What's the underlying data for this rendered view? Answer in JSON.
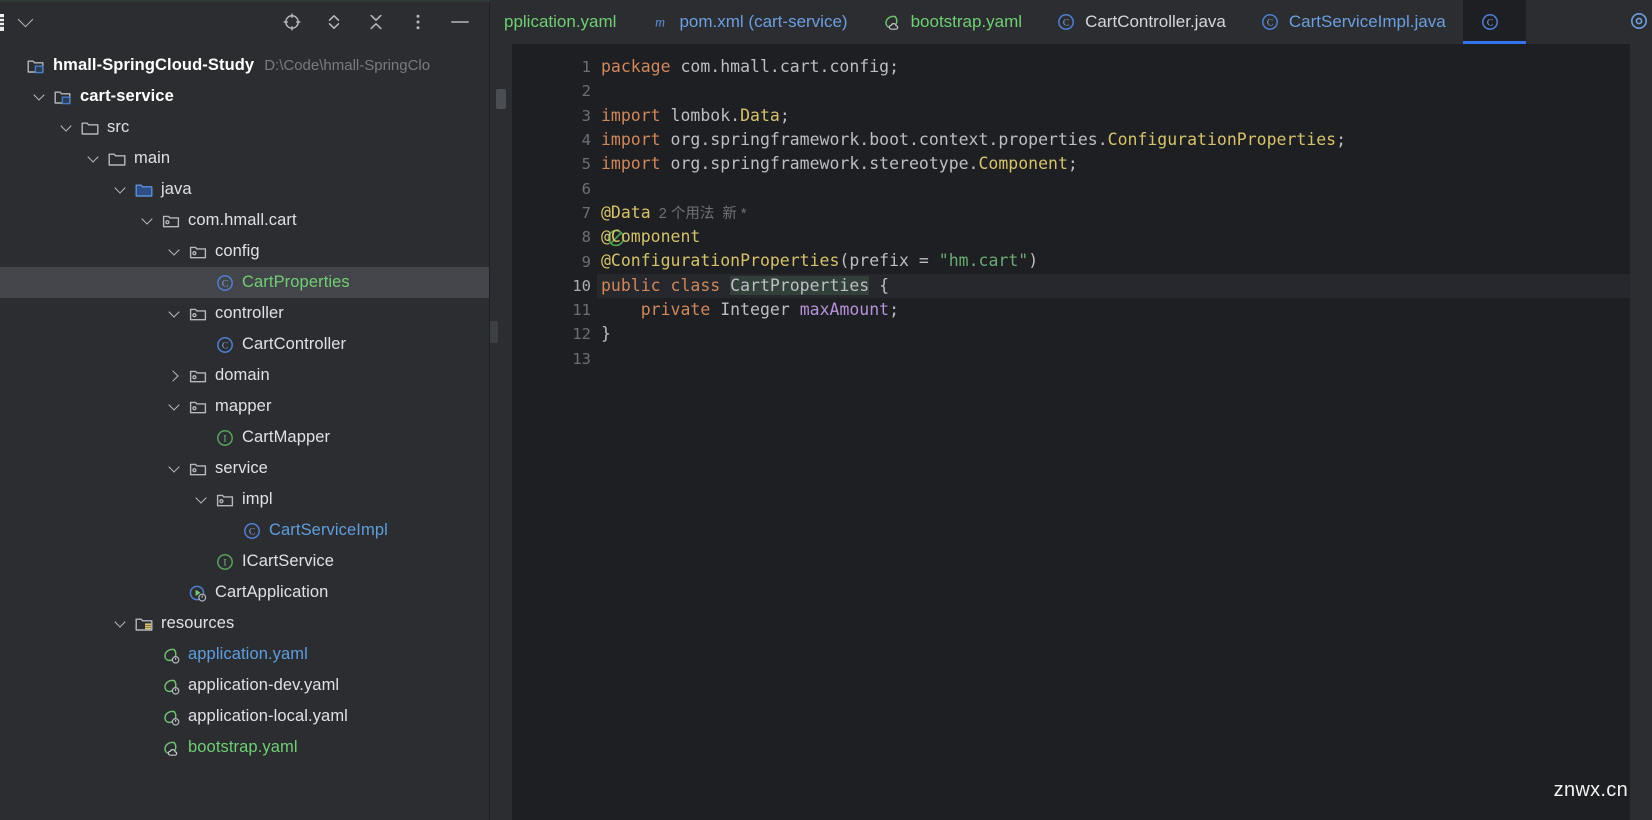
{
  "window": {
    "watermark": "znwx.cn"
  },
  "project_panel": {
    "toolbar": {
      "project_selector_label": "",
      "icons": [
        {
          "name": "locate-icon",
          "title": "Select Opened File"
        },
        {
          "name": "expand-all-icon",
          "title": "Expand All"
        },
        {
          "name": "collapse-all-icon",
          "title": "Collapse All"
        },
        {
          "name": "more-options-icon",
          "title": "Options"
        },
        {
          "name": "minimize-icon",
          "title": "Hide"
        }
      ]
    },
    "tree": [
      {
        "label": "hmall-SpringCloud-Study",
        "path": "D:\\Code\\hmall-SpringClo",
        "icon": "module-folder-icon",
        "indent": 0,
        "arrow": "none",
        "style": "bold",
        "selected": false
      },
      {
        "label": "cart-service",
        "path": "",
        "icon": "module-folder-icon",
        "indent": 1,
        "arrow": "down",
        "style": "bold",
        "selected": false
      },
      {
        "label": "src",
        "path": "",
        "icon": "folder-icon",
        "indent": 2,
        "arrow": "down",
        "style": "plain",
        "selected": false
      },
      {
        "label": "main",
        "path": "",
        "icon": "folder-icon",
        "indent": 3,
        "arrow": "down",
        "style": "plain",
        "selected": false
      },
      {
        "label": "java",
        "path": "",
        "icon": "source-folder-icon",
        "indent": 4,
        "arrow": "down",
        "style": "plain",
        "selected": false
      },
      {
        "label": "com.hmall.cart",
        "path": "",
        "icon": "package-icon",
        "indent": 5,
        "arrow": "down",
        "style": "plain",
        "selected": false
      },
      {
        "label": "config",
        "path": "",
        "icon": "package-icon",
        "indent": 6,
        "arrow": "down",
        "style": "plain",
        "selected": false
      },
      {
        "label": "CartProperties",
        "path": "",
        "icon": "java-class-icon",
        "indent": 7,
        "arrow": "none",
        "style": "green",
        "selected": true
      },
      {
        "label": "controller",
        "path": "",
        "icon": "package-icon",
        "indent": 6,
        "arrow": "down",
        "style": "plain",
        "selected": false
      },
      {
        "label": "CartController",
        "path": "",
        "icon": "java-class-icon",
        "indent": 7,
        "arrow": "none",
        "style": "plain",
        "selected": false
      },
      {
        "label": "domain",
        "path": "",
        "icon": "package-icon",
        "indent": 6,
        "arrow": "right",
        "style": "plain",
        "selected": false
      },
      {
        "label": "mapper",
        "path": "",
        "icon": "package-icon",
        "indent": 6,
        "arrow": "down",
        "style": "plain",
        "selected": false
      },
      {
        "label": "CartMapper",
        "path": "",
        "icon": "java-interface-icon",
        "indent": 7,
        "arrow": "none",
        "style": "plain",
        "selected": false
      },
      {
        "label": "service",
        "path": "",
        "icon": "package-icon",
        "indent": 6,
        "arrow": "down",
        "style": "plain",
        "selected": false
      },
      {
        "label": "impl",
        "path": "",
        "icon": "package-icon",
        "indent": 7,
        "arrow": "down",
        "style": "plain",
        "selected": false
      },
      {
        "label": "CartServiceImpl",
        "path": "",
        "icon": "java-class-icon",
        "indent": 8,
        "arrow": "none",
        "style": "blue",
        "selected": false
      },
      {
        "label": "ICartService",
        "path": "",
        "icon": "java-interface-icon",
        "indent": 7,
        "arrow": "none",
        "style": "plain",
        "selected": false
      },
      {
        "label": "CartApplication",
        "path": "",
        "icon": "spring-boot-class-icon",
        "indent": 6,
        "arrow": "none",
        "style": "plain",
        "selected": false
      },
      {
        "label": "resources",
        "path": "",
        "icon": "resources-folder-icon",
        "indent": 4,
        "arrow": "down",
        "style": "plain",
        "selected": false
      },
      {
        "label": "application.yaml",
        "path": "",
        "icon": "spring-yaml-icon",
        "indent": 5,
        "arrow": "none",
        "style": "blue",
        "selected": false
      },
      {
        "label": "application-dev.yaml",
        "path": "",
        "icon": "spring-yaml-icon",
        "indent": 5,
        "arrow": "none",
        "style": "plain",
        "selected": false
      },
      {
        "label": "application-local.yaml",
        "path": "",
        "icon": "spring-yaml-icon",
        "indent": 5,
        "arrow": "none",
        "style": "plain",
        "selected": false
      },
      {
        "label": "bootstrap.yaml",
        "path": "",
        "icon": "spring-cloud-yaml-icon",
        "indent": 5,
        "arrow": "none",
        "style": "green",
        "selected": false
      }
    ]
  },
  "editor": {
    "tabs": [
      {
        "label": "pplication.yaml",
        "icon": "spring-yaml-icon",
        "color": "yaml-green",
        "active": false,
        "clipped": true
      },
      {
        "label": "pom.xml (cart-service)",
        "icon": "maven-icon",
        "color": "blue",
        "active": false,
        "clipped": false
      },
      {
        "label": "bootstrap.yaml",
        "icon": "spring-cloud-yaml-icon",
        "color": "yaml-green",
        "active": false,
        "clipped": false
      },
      {
        "label": "CartController.java",
        "icon": "java-class-icon",
        "color": "white",
        "active": false,
        "clipped": false
      },
      {
        "label": "CartServiceImpl.java",
        "icon": "java-class-icon",
        "color": "blue",
        "active": false,
        "clipped": false
      },
      {
        "label": "",
        "icon": "java-class-icon",
        "color": "white",
        "active": true,
        "clipped": true
      }
    ],
    "gutter": {
      "line_numbers": [
        "1",
        "2",
        "3",
        "4",
        "5",
        "6",
        "7",
        "8",
        "9",
        "10",
        "11",
        "12",
        "13"
      ],
      "current_line": "10",
      "run_markers": [
        {
          "line": "8",
          "name": "spring-bean-gutter-icon"
        },
        {
          "line": "10",
          "name": "spring-bean-gutter-icon"
        }
      ]
    },
    "code_lines": [
      {
        "n": "1",
        "tokens": [
          {
            "t": "package ",
            "c": "k-kw"
          },
          {
            "t": "com.hmall.cart.config",
            "c": "k-pl"
          },
          {
            "t": ";",
            "c": "k-punc"
          }
        ]
      },
      {
        "n": "2",
        "tokens": []
      },
      {
        "n": "3",
        "tokens": [
          {
            "t": "import ",
            "c": "k-kw"
          },
          {
            "t": "lombok.",
            "c": "k-pl"
          },
          {
            "t": "Data",
            "c": "k-type"
          },
          {
            "t": ";",
            "c": "k-punc"
          }
        ]
      },
      {
        "n": "4",
        "tokens": [
          {
            "t": "import ",
            "c": "k-kw"
          },
          {
            "t": "org.springframework.boot.context.properties.",
            "c": "k-pl"
          },
          {
            "t": "ConfigurationProperties",
            "c": "k-type"
          },
          {
            "t": ";",
            "c": "k-punc"
          }
        ]
      },
      {
        "n": "5",
        "tokens": [
          {
            "t": "import ",
            "c": "k-kw"
          },
          {
            "t": "org.springframework.stereotype.",
            "c": "k-pl"
          },
          {
            "t": "Component",
            "c": "k-type"
          },
          {
            "t": ";",
            "c": "k-punc"
          }
        ]
      },
      {
        "n": "6",
        "tokens": []
      },
      {
        "n": "7",
        "tokens": [
          {
            "t": "@Data",
            "c": "k-ann"
          },
          {
            "t": "  2 个用法  新 *",
            "c": "k-hint"
          }
        ]
      },
      {
        "n": "8",
        "tokens": [
          {
            "t": "@Component",
            "c": "k-ann"
          }
        ]
      },
      {
        "n": "9",
        "tokens": [
          {
            "t": "@ConfigurationProperties",
            "c": "k-ann"
          },
          {
            "t": "(",
            "c": "k-punc"
          },
          {
            "t": "prefix",
            "c": "k-pl"
          },
          {
            "t": " = ",
            "c": "k-punc"
          },
          {
            "t": "\"hm.cart\"",
            "c": "k-str"
          },
          {
            "t": ")",
            "c": "k-punc"
          }
        ]
      },
      {
        "n": "10",
        "tokens": [
          {
            "t": "public class ",
            "c": "k-kw"
          },
          {
            "t": "CARET",
            "c": "caret"
          },
          {
            "t": "CartProperties",
            "c": "k-pl k-cls-hl"
          },
          {
            "t": " {",
            "c": "k-punc"
          }
        ]
      },
      {
        "n": "11",
        "tokens": [
          {
            "t": "    private ",
            "c": "k-kw"
          },
          {
            "t": "Integer",
            "c": "k-pl"
          },
          {
            "t": " ",
            "c": "k-punc"
          },
          {
            "t": "maxAmount",
            "c": "k-field"
          },
          {
            "t": ";",
            "c": "k-punc"
          }
        ]
      },
      {
        "n": "12",
        "tokens": [
          {
            "t": "}",
            "c": "k-punc"
          }
        ]
      },
      {
        "n": "13",
        "tokens": []
      }
    ]
  },
  "colors": {
    "panel_bg": "#2b2d30",
    "editor_bg": "#1e1f22",
    "selection_bg": "#43454a",
    "accent_blue": "#3574f0",
    "keyword_orange": "#d0875a",
    "annotation_yellow": "#d5c26a",
    "string_green": "#6aab73",
    "field_purple": "#b692d8",
    "new_file_green": "#6fcf73",
    "modified_blue": "#5f9ede"
  }
}
